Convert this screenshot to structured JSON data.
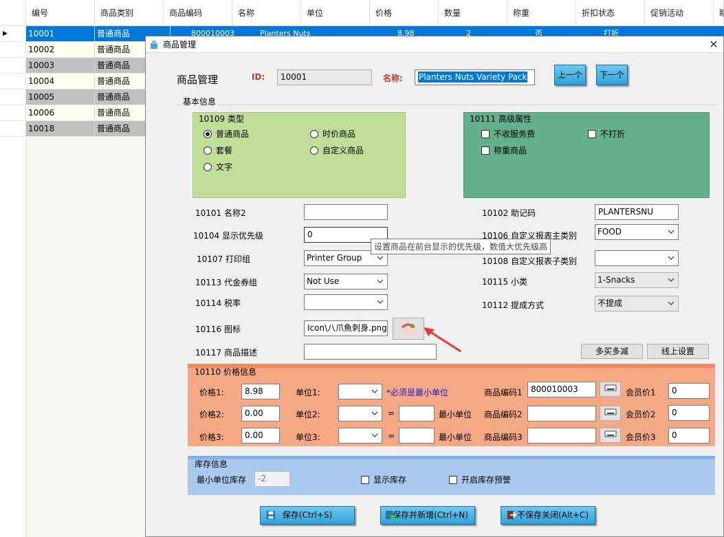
{
  "grid": {
    "columns": [
      "编号",
      "商品类别",
      "商品编码",
      "名称",
      "单位",
      "价格",
      "数量",
      "称重",
      "折扣状态",
      "促销活动",
      "眼"
    ],
    "rows": [
      {
        "id": "10001",
        "category": "普通商品",
        "code": "800010003",
        "name": "Planters Nuts",
        "price": "8.98",
        "qty": "2",
        "weigh": "否",
        "discount": "打折"
      },
      {
        "id": "10002",
        "category": "普通商品"
      },
      {
        "id": "10003",
        "category": "普通商品"
      },
      {
        "id": "10004",
        "category": "普通商品"
      },
      {
        "id": "10005",
        "category": "普通商品"
      },
      {
        "id": "10006",
        "category": "普通商品"
      },
      {
        "id": "10018",
        "category": "普通商品"
      }
    ]
  },
  "dialog": {
    "title": "商品管理",
    "heading": "商品管理",
    "id_label": "ID:",
    "id_value": "10001",
    "name_label": "名称:",
    "name_value": "Planters Nuts Variety Pack",
    "prev_button": "上一个",
    "next_button": "下一个",
    "basic_info": "基本信息",
    "type_group": {
      "title": "10109 类型",
      "options": [
        "普通商品",
        "时价商品",
        "套餐",
        "自定义商品",
        "文字"
      ],
      "selected": "普通商品"
    },
    "advanced_group": {
      "title": "10111 高级属性",
      "options": [
        "不收服务费",
        "不打折",
        "称重商品"
      ]
    },
    "fields": {
      "name2_label": "10101 名称2",
      "name2_value": "",
      "mnemonic_label": "10102 助记码",
      "mnemonic_value": "PLANTERSNU",
      "priority_label": "10104 显示优先级",
      "priority_value": "0",
      "report_main_label": "10106 自定义报表主类别",
      "report_main_value": "FOOD",
      "print_group_label": "10107 打印组",
      "print_group_value": "Printer Group",
      "report_sub_label": "10108 自定义报表子类别",
      "report_sub_value": "",
      "voucher_label": "10113 代金券组",
      "voucher_value": "Not Use",
      "subclass_label": "10115 小类",
      "subclass_value": "1-Snacks",
      "tax_label": "10114 税率",
      "tax_value": "",
      "commission_label": "10112 提成方式",
      "commission_value": "不提成",
      "icon_label": "10116 图标",
      "icon_value": "Icon\\八爪魚刺身.png",
      "desc_label": "10117 商品描述",
      "desc_value": ""
    },
    "tooltip": "设置商品在前台显示的优先级，数值大优先级高",
    "multi_buy_button": "多买多减",
    "online_settings_button": "线上设置",
    "price_group": {
      "title": "10110 价格信息",
      "rows": [
        {
          "price_label": "价格1:",
          "price": "8.98",
          "unit_label": "单位1:",
          "unit_note": "*必须是最小单位",
          "code_label": "商品编码1",
          "code": "800010003",
          "member_label": "会员价1",
          "member": "0"
        },
        {
          "price_label": "价格2:",
          "price": "0.00",
          "unit_label": "单位2:",
          "eq": "=",
          "unit_note": "最小单位",
          "code_label": "商品编码2",
          "code": "",
          "member_label": "会员价2",
          "member": "0"
        },
        {
          "price_label": "价格3:",
          "price": "0.00",
          "unit_label": "单位3:",
          "eq": "=",
          "unit_note": "最小单位",
          "code_label": "商品编码3",
          "code": "",
          "member_label": "会员价3",
          "member": "0"
        }
      ]
    },
    "stock_group": {
      "title": "库存信息",
      "min_stock_label": "最小单位库存",
      "min_stock_value": "-2",
      "show_stock": "显示库存",
      "stock_alert": "开启库存预警"
    },
    "save_button": "保存(Ctrl+S)",
    "save_new_button": "保存并新增(Ctrl+N)",
    "close_button": "不保存关闭(Alt+C)",
    "colors": {
      "type_group_bg": "#c0de98",
      "advanced_group_bg": "#63b08a",
      "price_group_bg": "#f4a884",
      "stock_group_bg": "#a9c9ef",
      "label_red": "#c0392b",
      "note_blue": "#1a1acd"
    }
  }
}
